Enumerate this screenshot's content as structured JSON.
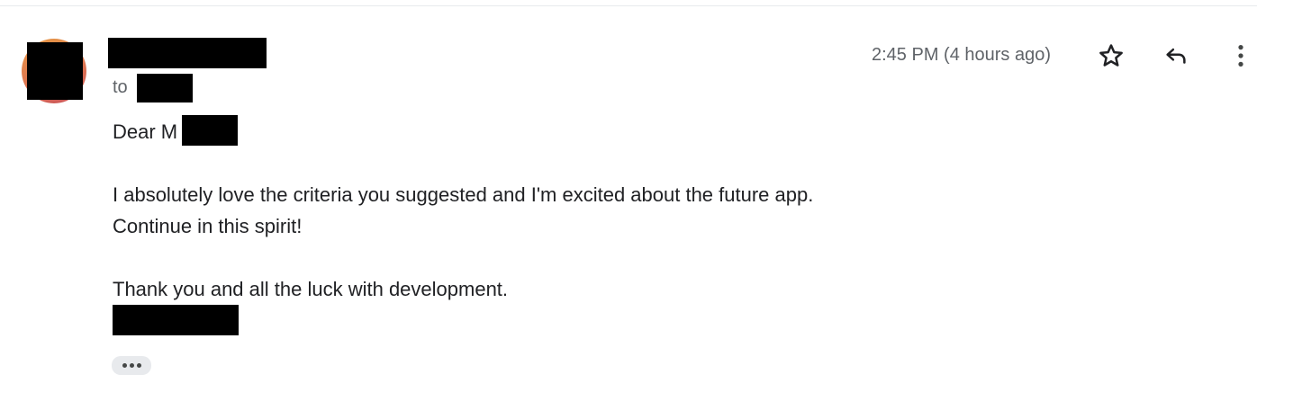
{
  "header": {
    "recipient_prefix": "to",
    "timestamp": "2:45 PM (4 hours ago)"
  },
  "actions": {
    "star_icon": "star-outline-icon",
    "reply_icon": "reply-icon",
    "more_icon": "more-vertical-icon"
  },
  "message": {
    "greeting": "Dear M",
    "line1": "I absolutely love the criteria you suggested and I'm excited about the future app.",
    "line2": "Continue in this spirit!",
    "line3": "Thank you and all the luck with development."
  },
  "colors": {
    "text_primary": "#202124",
    "text_secondary": "#5f6368",
    "redaction": "#000000",
    "pill_background": "#e8eaed"
  }
}
